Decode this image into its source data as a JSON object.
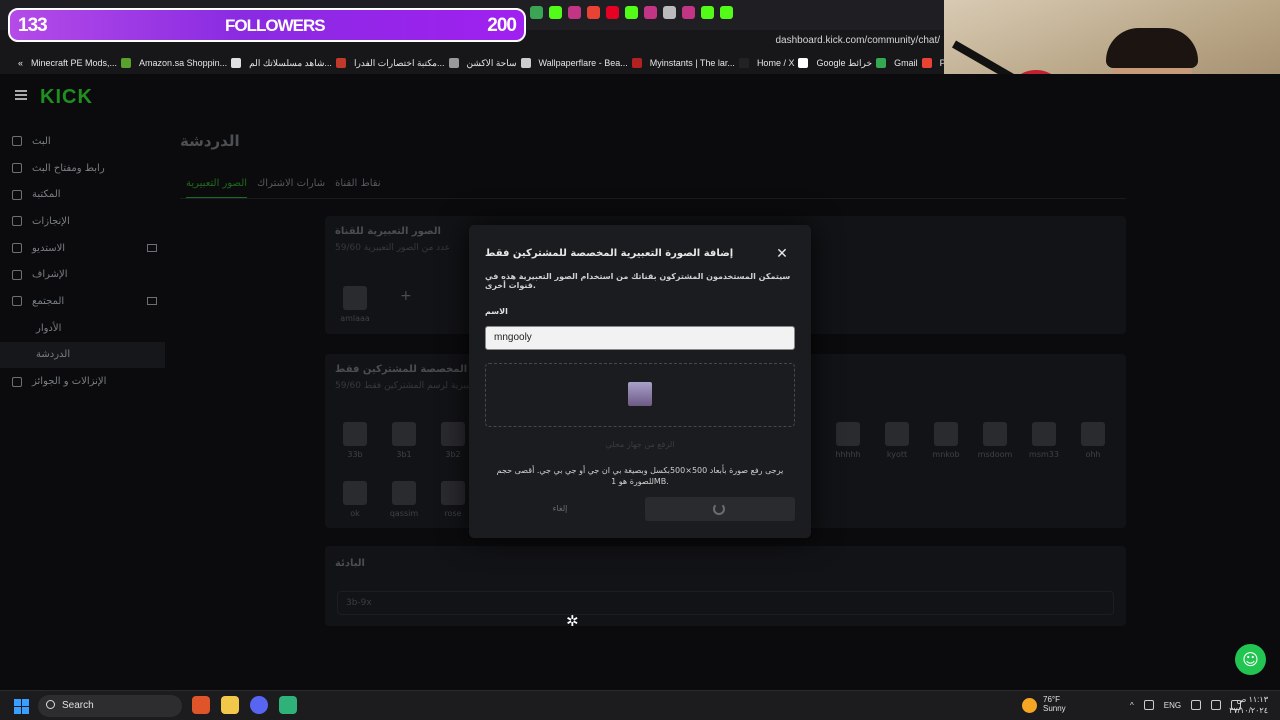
{
  "overlay": {
    "followers_count": "133",
    "followers_title": "FOLLOWERS",
    "followers_goal": "200"
  },
  "browser": {
    "url": "dashboard.kick.com/community/chat/",
    "bookmarks": [
      {
        "label": "Minecraft PE Mods,...",
        "color": "#5aa02c"
      },
      {
        "label": "Amazon.sa Shoppin...",
        "color": "#e0e0e0"
      },
      {
        "label": "شاهد مسلسلاتك الم...",
        "color": "#c0392b"
      },
      {
        "label": "مكتبة اختصارات الفدرا...",
        "color": "#999999"
      },
      {
        "label": "ساحة الاكشن",
        "color": "#cccccc"
      },
      {
        "label": "Wallpaperflare - Bea...",
        "color": "#b22222"
      },
      {
        "label": "Myinstants | The lar...",
        "color": "#222222"
      },
      {
        "label": "Home / X",
        "color": "#ffffff"
      },
      {
        "label": "Google خرائط",
        "color": "#34a853"
      },
      {
        "label": "Gmail",
        "color": "#ea4335"
      },
      {
        "label": "Profile",
        "color": "#e91e63"
      }
    ]
  },
  "kick": {
    "logo": "KICK",
    "sidebar": [
      {
        "label": "البث",
        "sub": false,
        "active": false
      },
      {
        "label": "رابط ومفتاح البث",
        "sub": false,
        "active": false
      },
      {
        "label": "المكتبة",
        "sub": false,
        "active": false
      },
      {
        "label": "الإنجازات",
        "sub": false,
        "active": false
      },
      {
        "label": "الاستديو",
        "sub": false,
        "active": false
      },
      {
        "label": "الإشراف",
        "sub": false,
        "active": false
      },
      {
        "label": "المجتمع",
        "sub": false,
        "active": false
      },
      {
        "label": "الأدوار",
        "sub": true,
        "active": false
      },
      {
        "label": "الدردشة",
        "sub": true,
        "active": true
      },
      {
        "label": "الإنزالات و الجوائز",
        "sub": false,
        "active": false
      }
    ],
    "page_title": "الدردشة",
    "tabs": [
      {
        "label": "الصور التعبيرية",
        "active": true
      },
      {
        "label": "شارات الاشتراك",
        "active": false
      },
      {
        "label": "نقاط القناة",
        "active": false
      }
    ],
    "channel_emotes": {
      "title": "الصور التعبيرية للقناة",
      "subtitle": "59/60 عدد من الصور التعبيرية",
      "items": [
        "amlaaa"
      ]
    },
    "subscriber_emotes": {
      "title": "الصور التعبيرية المخصصة للمشتركين فقط",
      "subtitle": "59/60 الصور التعبيرية لرسم المشتركين فقط",
      "left_items": [
        "33b",
        "3b1",
        "3b2",
        "ok",
        "qassim",
        "rose"
      ],
      "right_items": [
        "hhhhh",
        "kyott",
        "mnkob",
        "msdoom",
        "msm33",
        "ohh"
      ]
    },
    "kickid": {
      "title": "البادئة",
      "value": "3b-9x"
    }
  },
  "modal": {
    "title": "إضافة الصورة التعبيرية المخصصة للمشتركين فقط",
    "description": "سيتمكن المستخدمون المشتركون بقناتك من استخدام الصور التعبيرية هذه في قنوات أخرى.",
    "name_label": "الاسم",
    "name_value": "mngooly",
    "upload_label": "الرفع من جهاز محلي",
    "upload_note": "يرجى رفع صورة بأبعاد 500×500بكسل وبصيغة بي ان جي أو جي بي جي. أقصى حجم للصورة هو 1MB.",
    "cancel": "إلغاء"
  },
  "taskbar": {
    "search": "Search",
    "weather_temp": "76°F",
    "weather_desc": "Sunny",
    "lang": "ENG",
    "time": "١١:١٣ ص",
    "date": "٢٧/١٠/٢٠٢٤"
  }
}
